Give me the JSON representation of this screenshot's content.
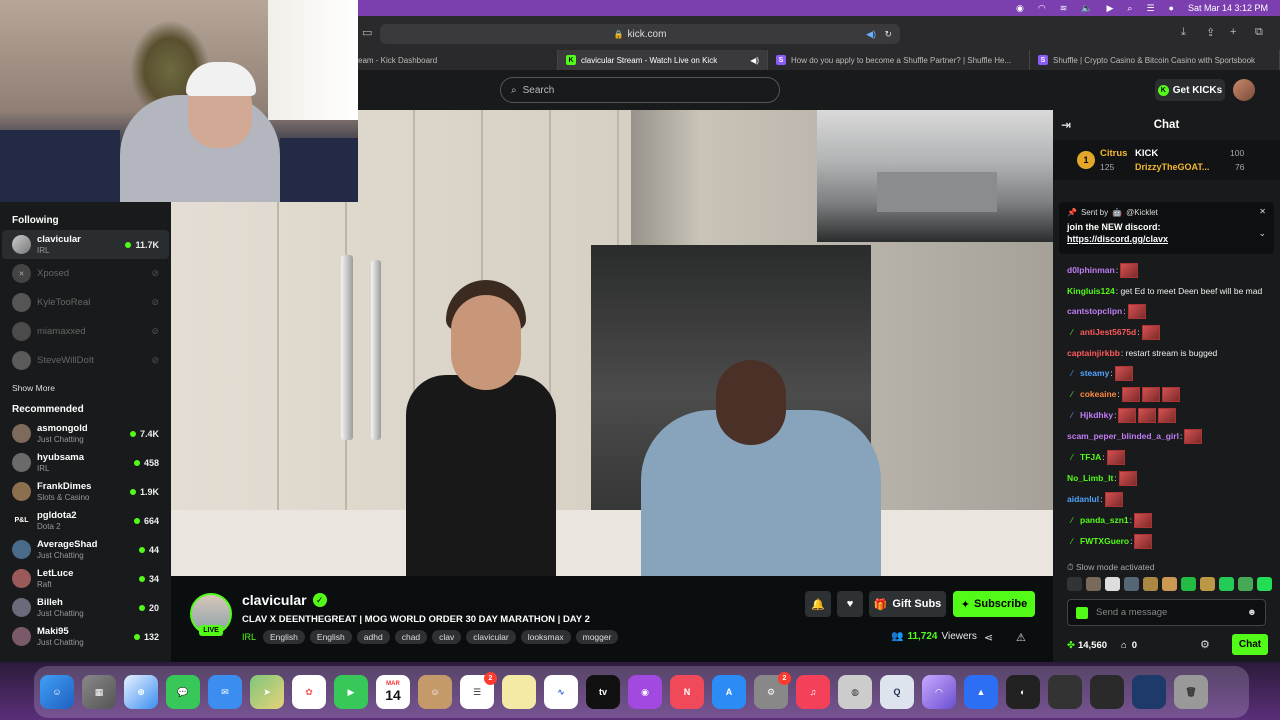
{
  "menubar": {
    "datetime": "Sat Mar 14  3:12 PM"
  },
  "browser": {
    "url": "kick.com",
    "tabs": [
      {
        "label": "eam - Kick Dashboard",
        "active": false
      },
      {
        "label": "clavicular Stream - Watch Live on Kick",
        "active": true
      },
      {
        "label": "How do you apply to become a Shuffle Partner? | Shuffle He...",
        "active": false
      },
      {
        "label": "Shuffle | Crypto Casino & Bitcoin Casino with Sportsbook",
        "active": false
      }
    ]
  },
  "header": {
    "search_placeholder": "Search",
    "get_kicks": "Get KICKs"
  },
  "sidebar": {
    "following_title": "Following",
    "following": [
      {
        "name": "clavicular",
        "cat": "IRL",
        "count": "11.7K",
        "live": true
      },
      {
        "name": "Xposed",
        "live": false
      },
      {
        "name": "KyleTooReal",
        "live": false
      },
      {
        "name": "miamaxxed",
        "live": false
      },
      {
        "name": "SteveWillDoIt",
        "live": false
      }
    ],
    "show_more": "Show More",
    "recommended_title": "Recommended",
    "recommended": [
      {
        "name": "asmongold",
        "cat": "Just Chatting",
        "count": "7.4K"
      },
      {
        "name": "hyubsama",
        "cat": "IRL",
        "count": "458"
      },
      {
        "name": "FrankDimes",
        "cat": "Slots & Casino",
        "count": "1.9K"
      },
      {
        "name": "pgldota2",
        "cat": "Dota 2",
        "count": "664"
      },
      {
        "name": "AverageShad",
        "cat": "Just Chatting",
        "count": "44"
      },
      {
        "name": "LetLuce",
        "cat": "Raft",
        "count": "34"
      },
      {
        "name": "Billeh",
        "cat": "Just Chatting",
        "count": "20"
      },
      {
        "name": "Maki95",
        "cat": "Just Chatting",
        "count": "132"
      }
    ]
  },
  "stream": {
    "live": "LIVE",
    "name": "clavicular",
    "title": "CLAV X DEENTHEGREAT | MOG WORLD ORDER 30 DAY MARATHON | DAY 2",
    "category": "IRL",
    "tags": [
      "English",
      "English",
      "adhd",
      "chad",
      "clav",
      "clavicular",
      "looksmax",
      "mogger"
    ],
    "gift_subs": "Gift Subs",
    "subscribe": "Subscribe",
    "viewers_count": "11,724",
    "viewers_label": "Viewers"
  },
  "chat": {
    "title": "Chat",
    "leader": {
      "rank": "1",
      "a_name": "Citrus",
      "a_val": "125",
      "b_name": "KICK",
      "b_val": "100",
      "c_name": "DrizzyTheGOAT...",
      "c_val": "76"
    },
    "pinned": {
      "sent_by": "Sent by",
      "author": "@Kicklet",
      "text": "join the NEW discord:",
      "link": "https://discord.gg/clavx"
    },
    "messages": [
      {
        "user": "d0lphinman",
        "text": ":",
        "color": "#c07cf5",
        "badge": "",
        "emotes": 1
      },
      {
        "user": "Kingluis124",
        "text": ": get Ed to meet Deen beef will be mad",
        "color": "#53fc18",
        "badge": "",
        "emotes": 0
      },
      {
        "user": "cantstopclipn",
        "text": ":",
        "color": "#c07cf5",
        "badge": "",
        "emotes": 1
      },
      {
        "user": "antiJest5675d",
        "text": ":",
        "color": "#ff5a5a",
        "badge": "g",
        "emotes": 1
      },
      {
        "user": "captainjirkbb",
        "text": ": restart stream is bugged",
        "color": "#ff5a5a",
        "badge": "",
        "emotes": 0
      },
      {
        "user": "steamy",
        "text": ":",
        "color": "#53a3ff",
        "badge": "b",
        "emotes": 1
      },
      {
        "user": "cokeaine",
        "text": ":",
        "color": "#ff8a3d",
        "badge": "g",
        "emotes": 3
      },
      {
        "user": "Hjkdhky",
        "text": ":",
        "color": "#c07cf5",
        "badge": "b",
        "emotes": 3
      },
      {
        "user": "scam_peper_blinded_a_girl",
        "text": ":",
        "color": "#c07cf5",
        "badge": "",
        "emotes": 1
      },
      {
        "user": "TFJA",
        "text": ":",
        "color": "#53fc18",
        "badge": "g",
        "emotes": 1
      },
      {
        "user": "No_Limb_It",
        "text": ":",
        "color": "#53fc18",
        "badge": "",
        "emotes": 1
      },
      {
        "user": "aidanlul",
        "text": ":",
        "color": "#53a3ff",
        "badge": "",
        "emotes": 1
      },
      {
        "user": "panda_szn1",
        "text": ":",
        "color": "#53fc18",
        "badge": "g",
        "emotes": 1
      },
      {
        "user": "FWTXGuero",
        "text": ":",
        "color": "#53fc18",
        "badge": "g",
        "emotes": 1
      }
    ],
    "slow_mode": "Slow mode activated",
    "input_placeholder": "Send a message",
    "kicks": "14,560",
    "gifts": "0",
    "send": "Chat"
  },
  "dock": {
    "cal_month": "MAR",
    "cal_day": "14",
    "badge_reminders": "2",
    "badge_settings": "2"
  }
}
